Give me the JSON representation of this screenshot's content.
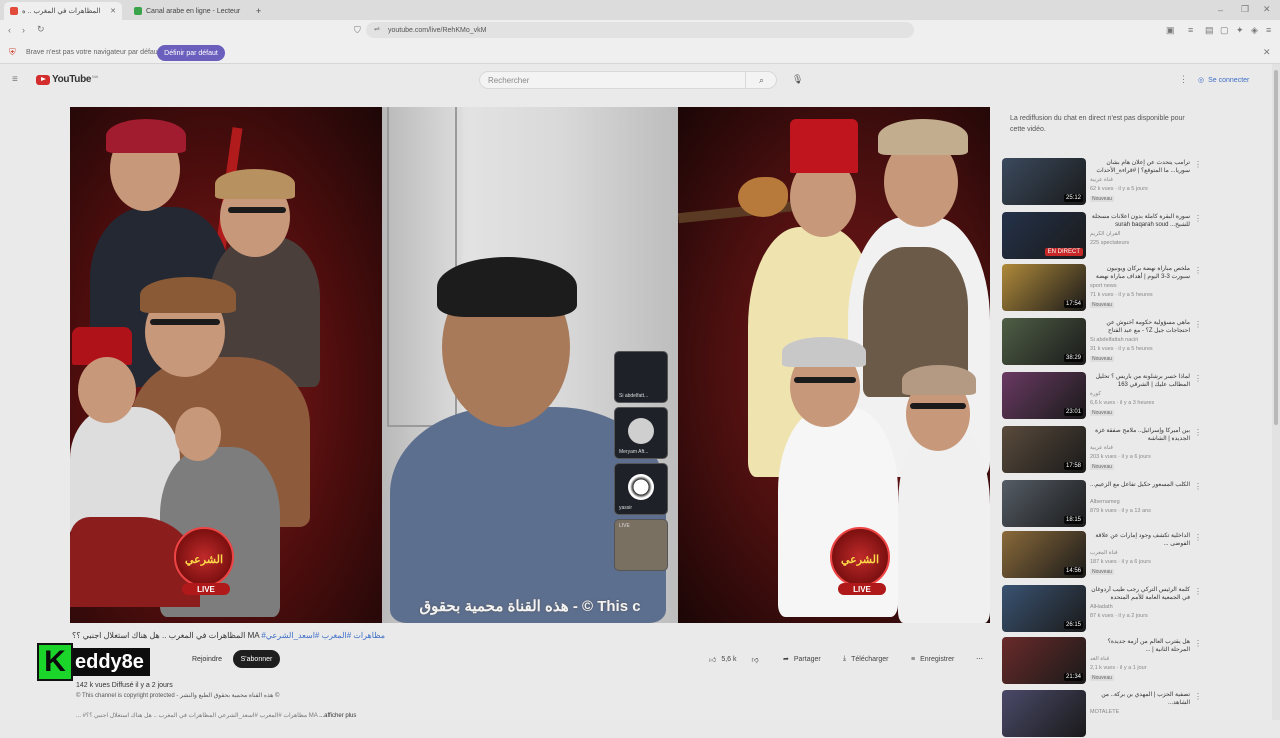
{
  "browser": {
    "tabs": [
      {
        "title": "المظاهرات في المغرب .. ه",
        "active": true,
        "color": "#e24a3c"
      },
      {
        "title": "Canal arabe en ligne - Lecteur",
        "active": false,
        "color": "#3aa44a"
      }
    ],
    "new_tab": "+",
    "url": "youtube.com/live/RehKMo_vkM",
    "infobar": {
      "message": "Brave n'est pas votre navigateur par défaut",
      "button": "Définir par défaut"
    }
  },
  "youtube": {
    "logo_text": "YouTube",
    "logo_country": "MA",
    "search_placeholder": "Rechercher",
    "signin": "Se connecter",
    "chat_replay_message": "La rediffusion du chat en direct n'est pas disponible pour cette vidéo.",
    "video": {
      "watermark": "هذه القناة محمية بحقوق - © This c",
      "live_label": "LIVE",
      "badge_text": "الشرعي",
      "tiles": [
        {
          "label": "Si abdelfatt..."
        },
        {
          "label": "Meryam Aft..."
        },
        {
          "label": "yassir"
        },
        {
          "label": "LIVE"
        }
      ]
    },
    "title_hashtags": "#مظاهرات #المغرب #اسعد_الشرعي",
    "title_text": "المظاهرات في المغرب .. هل هناك استغلال اجنبي ؟؟ MA",
    "join_label": "Rejoindre",
    "subscribe_label": "S'abonner",
    "likes": "5,6 k",
    "share_label": "Partager",
    "download_label": "Télécharger",
    "save_label": "Enregistrer",
    "meta": "142 k vues  Diffusé il y a 2 jours",
    "description_line1": "© This channel is copyright protected - هذه القناة محمية بحقوق الطبع والنشر ©",
    "description_line2": "... #مظاهرات #المغرب #اسعد_الشرعي المظاهرات في المغرب .. هل هناك استغلال اجنبي ؟؟ MA",
    "show_more": "...afficher plus",
    "watermark_logo": {
      "k": "K",
      "rest": "eddy8e"
    },
    "recommendations": [
      {
        "title": "ترامب يتحدث عن إعلان هام بشأن سوريا... ما المتوقع؟ | #قراءة_الأحداث",
        "channel": "قناة عربية",
        "views": "62 k vues · il y a 5 jours",
        "badge": "Nouveau",
        "duration": "25:12",
        "live": false,
        "color": "#3b4a5e"
      },
      {
        "title": "سورة البقرة كاملة بدون اعلانات مسجلة للشيخ... surah baqarah soud",
        "channel": "القرآن الكريم",
        "views": "225 spectateurs",
        "badge": "",
        "duration": "EN DIRECT",
        "live": true,
        "color": "#24324a"
      },
      {
        "title": "ملخص مباراة نهضة بركان ويونيون سبورت 3-3 اليوم | أهداف مباراة نهضة",
        "channel": "sport news",
        "views": "71 k vues · il y a 5 heures",
        "badge": "Nouveau",
        "duration": "17:54",
        "live": false,
        "color": "#b08a3a"
      },
      {
        "title": "ماهي مسؤولية حكومة أخنوش عن احتجاجات جيل Z؟ - مع عبد الفتاح الحيداوي",
        "channel": "Si abdelfattah naciri",
        "views": "31 k vues · il y a 5 heures",
        "badge": "Nouveau",
        "duration": "38:29",
        "live": false,
        "color": "#4f5f45"
      },
      {
        "title": "لماذا خسر برشلونة من باريس ؟ تحليل المطالب عليك | الشرقي 163",
        "channel": "كورة",
        "views": "6,6 k vues · il y a 3 heures",
        "badge": "Nouveau",
        "duration": "23:01",
        "live": false,
        "color": "#6a3a63"
      },
      {
        "title": "بين أميركا وإسرائيل.. ملامح صفقة غزة الجديدة | الشاشة",
        "channel": "قناة عربية",
        "views": "203 k vues · il y a 6 jours",
        "badge": "Nouveau",
        "duration": "17:58",
        "live": false,
        "color": "#5a4b3c"
      },
      {
        "title": "الكلب المسعور حكيل تفاعل مع الزعيم...",
        "channel": "Albernameg",
        "views": "879 k vues · il y a 13 ans",
        "badge": "",
        "duration": "18:15",
        "live": false,
        "color": "#555d66"
      },
      {
        "title": "الداخلية تكشف وجود إمارات عن علاقة الفوضى ...",
        "channel": "قناة المغرب",
        "views": "187 k vues · il y a 6 jours",
        "badge": "Nouveau",
        "duration": "14:56",
        "live": false,
        "color": "#8a6a3a"
      },
      {
        "title": "كلمة الرئيس التركي رجب طيب أردوغان في الجمعية العامة للأمم المتحدة",
        "channel": "AlHadath",
        "views": "87 k vues · il y a 2 jours",
        "badge": "",
        "duration": "26:15",
        "live": false,
        "color": "#3a5372"
      },
      {
        "title": "هل يقترب العالم من أزمة جديدة؟ المرحلة الثانية | ...",
        "channel": "قناة الغد",
        "views": "2,1 k vues · il y a 1 jour",
        "badge": "Nouveau",
        "duration": "21:34",
        "live": false,
        "color": "#6a2a2a"
      },
      {
        "title": "تصفية الحزب | المهدي بن بركة.. من الشاهد...",
        "channel": "MOTALETE",
        "views": "",
        "badge": "",
        "duration": "",
        "live": false,
        "color": "#4a4a6a"
      }
    ]
  },
  "colors": {
    "accent": "#6b5fbe",
    "youtube_red": "#d32d2d",
    "link": "#3e6fc7"
  }
}
